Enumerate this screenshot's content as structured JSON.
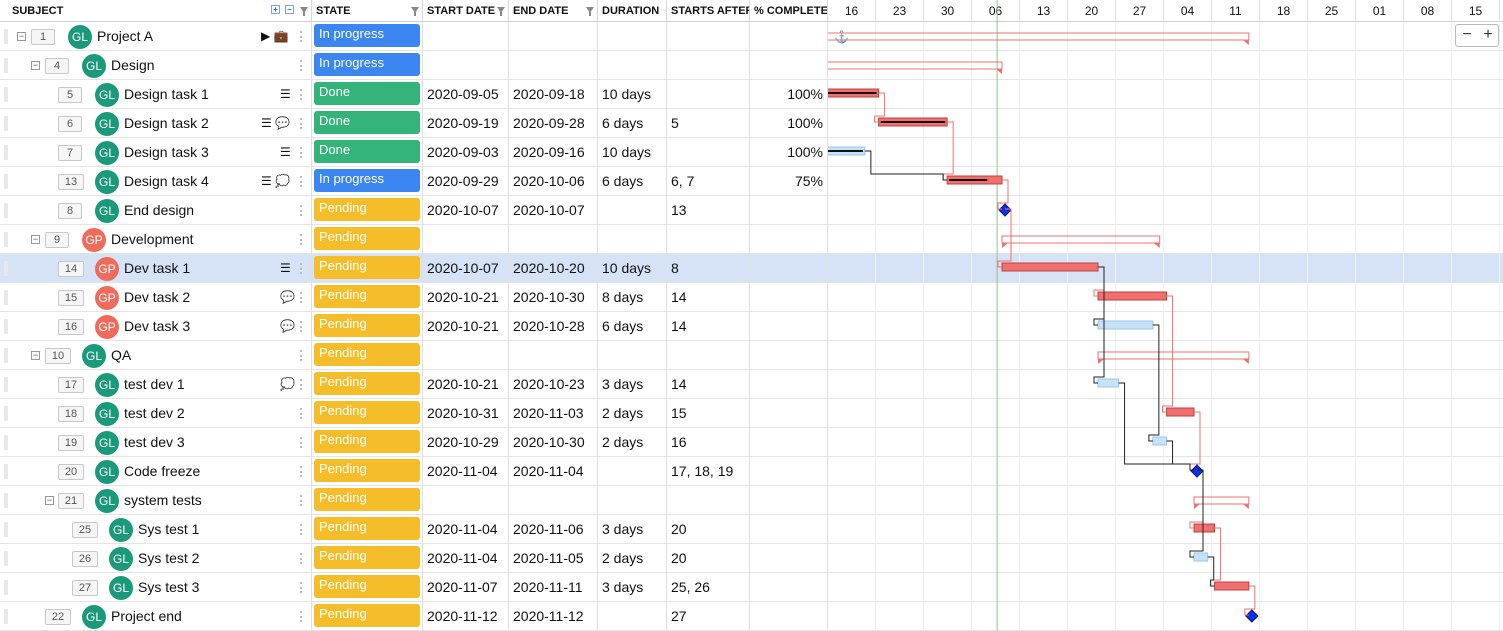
{
  "columns": {
    "subject": "SUBJECT",
    "state": "STATE",
    "start": "START DATE",
    "end": "END DATE",
    "duration": "DURATION",
    "starts_after": "STARTS AFTER",
    "complete": "% COMPLETE"
  },
  "timeline_ticks": [
    "16",
    "23",
    "30",
    "06",
    "13",
    "20",
    "27",
    "04",
    "11",
    "18",
    "25",
    "01",
    "08",
    "15"
  ],
  "zoom": {
    "minus": "−",
    "plus": "+"
  },
  "anchor_icon": "anchor-icon",
  "colors": {
    "in_progress": "#3b86f0",
    "done": "#34b47a",
    "pending": "#f5bd2a",
    "gl": "#1a9a7a",
    "gp": "#ef6b5b",
    "today_line": "#8fc28f",
    "milestone": "#1030e0"
  },
  "rows": [
    {
      "id": "1",
      "level": 0,
      "toggle": "−",
      "avatar": "GL",
      "name": "Project A",
      "icons": "▶ 💼",
      "state": "In progress",
      "state_cls": "st-prog",
      "start": "",
      "end": "",
      "duration": "",
      "after": "",
      "complete": ""
    },
    {
      "id": "4",
      "level": 1,
      "toggle": "−",
      "avatar": "GL",
      "name": "Design",
      "icons": "",
      "state": "In progress",
      "state_cls": "st-prog",
      "start": "",
      "end": "",
      "duration": "",
      "after": "",
      "complete": ""
    },
    {
      "id": "5",
      "level": 2,
      "toggle": "",
      "avatar": "GL",
      "name": "Design task 1",
      "icons": "☰",
      "state": "Done",
      "state_cls": "st-done",
      "start": "2020-09-05",
      "end": "2020-09-18",
      "duration": "10 days",
      "after": "",
      "complete": "100%"
    },
    {
      "id": "6",
      "level": 2,
      "toggle": "",
      "avatar": "GL",
      "name": "Design task 2",
      "icons": "☰ 💬",
      "state": "Done",
      "state_cls": "st-done",
      "start": "2020-09-19",
      "end": "2020-09-28",
      "duration": "6 days",
      "after": "5",
      "complete": "100%"
    },
    {
      "id": "7",
      "level": 2,
      "toggle": "",
      "avatar": "GL",
      "name": "Design task 3",
      "icons": "☰",
      "state": "Done",
      "state_cls": "st-done",
      "start": "2020-09-03",
      "end": "2020-09-16",
      "duration": "10 days",
      "after": "",
      "complete": "100%"
    },
    {
      "id": "13",
      "level": 2,
      "toggle": "",
      "avatar": "GL",
      "name": "Design task 4",
      "icons": "☰ 💭",
      "state": "In progress",
      "state_cls": "st-prog",
      "start": "2020-09-29",
      "end": "2020-10-06",
      "duration": "6 days",
      "after": "6, 7",
      "complete": "75%"
    },
    {
      "id": "8",
      "level": 2,
      "toggle": "",
      "avatar": "GL",
      "name": "End design",
      "icons": "",
      "state": "Pending",
      "state_cls": "st-pend",
      "start": "2020-10-07",
      "end": "2020-10-07",
      "duration": "",
      "after": "13",
      "complete": ""
    },
    {
      "id": "9",
      "level": 1,
      "toggle": "−",
      "avatar": "GP",
      "name": "Development",
      "icons": "",
      "state": "Pending",
      "state_cls": "st-pend",
      "start": "",
      "end": "",
      "duration": "",
      "after": "",
      "complete": ""
    },
    {
      "id": "14",
      "level": 2,
      "toggle": "",
      "avatar": "GP",
      "name": "Dev task 1",
      "icons": "☰",
      "state": "Pending",
      "state_cls": "st-pend",
      "start": "2020-10-07",
      "end": "2020-10-20",
      "duration": "10 days",
      "after": "8",
      "complete": "",
      "selected": true
    },
    {
      "id": "15",
      "level": 2,
      "toggle": "",
      "avatar": "GP",
      "name": "Dev task 2",
      "icons": "💬",
      "state": "Pending",
      "state_cls": "st-pend",
      "start": "2020-10-21",
      "end": "2020-10-30",
      "duration": "8 days",
      "after": "14",
      "complete": ""
    },
    {
      "id": "16",
      "level": 2,
      "toggle": "",
      "avatar": "GP",
      "name": "Dev task 3",
      "icons": "💬",
      "state": "Pending",
      "state_cls": "st-pend",
      "start": "2020-10-21",
      "end": "2020-10-28",
      "duration": "6 days",
      "after": "14",
      "complete": ""
    },
    {
      "id": "10",
      "level": 1,
      "toggle": "−",
      "avatar": "GL",
      "name": "QA",
      "icons": "",
      "state": "Pending",
      "state_cls": "st-pend",
      "start": "",
      "end": "",
      "duration": "",
      "after": "",
      "complete": ""
    },
    {
      "id": "17",
      "level": 2,
      "toggle": "",
      "avatar": "GL",
      "name": "test dev 1",
      "icons": "💭",
      "state": "Pending",
      "state_cls": "st-pend",
      "start": "2020-10-21",
      "end": "2020-10-23",
      "duration": "3 days",
      "after": "14",
      "complete": ""
    },
    {
      "id": "18",
      "level": 2,
      "toggle": "",
      "avatar": "GL",
      "name": "test dev 2",
      "icons": "",
      "state": "Pending",
      "state_cls": "st-pend",
      "start": "2020-10-31",
      "end": "2020-11-03",
      "duration": "2 days",
      "after": "15",
      "complete": ""
    },
    {
      "id": "19",
      "level": 2,
      "toggle": "",
      "avatar": "GL",
      "name": "test dev 3",
      "icons": "",
      "state": "Pending",
      "state_cls": "st-pend",
      "start": "2020-10-29",
      "end": "2020-10-30",
      "duration": "2 days",
      "after": "16",
      "complete": ""
    },
    {
      "id": "20",
      "level": 2,
      "toggle": "",
      "avatar": "GL",
      "name": "Code freeze",
      "icons": "",
      "state": "Pending",
      "state_cls": "st-pend",
      "start": "2020-11-04",
      "end": "2020-11-04",
      "duration": "",
      "after": "17, 18, 19",
      "complete": ""
    },
    {
      "id": "21",
      "level": 2,
      "toggle": "−",
      "avatar": "GL",
      "name": "system tests",
      "icons": "",
      "state": "Pending",
      "state_cls": "st-pend",
      "start": "",
      "end": "",
      "duration": "",
      "after": "",
      "complete": ""
    },
    {
      "id": "25",
      "level": 3,
      "toggle": "",
      "avatar": "GL",
      "name": "Sys test 1",
      "icons": "",
      "state": "Pending",
      "state_cls": "st-pend",
      "start": "2020-11-04",
      "end": "2020-11-06",
      "duration": "3 days",
      "after": "20",
      "complete": ""
    },
    {
      "id": "26",
      "level": 3,
      "toggle": "",
      "avatar": "GL",
      "name": "Sys test 2",
      "icons": "",
      "state": "Pending",
      "state_cls": "st-pend",
      "start": "2020-11-04",
      "end": "2020-11-05",
      "duration": "2 days",
      "after": "20",
      "complete": ""
    },
    {
      "id": "27",
      "level": 3,
      "toggle": "",
      "avatar": "GL",
      "name": "Sys test 3",
      "icons": "",
      "state": "Pending",
      "state_cls": "st-pend",
      "start": "2020-11-07",
      "end": "2020-11-11",
      "duration": "3 days",
      "after": "25, 26",
      "complete": ""
    },
    {
      "id": "22",
      "level": 1,
      "toggle": "",
      "avatar": "GL",
      "name": "Project end",
      "icons": "",
      "state": "Pending",
      "state_cls": "st-pend",
      "start": "2020-11-12",
      "end": "2020-11-12",
      "duration": "",
      "after": "27",
      "complete": ""
    }
  ]
}
